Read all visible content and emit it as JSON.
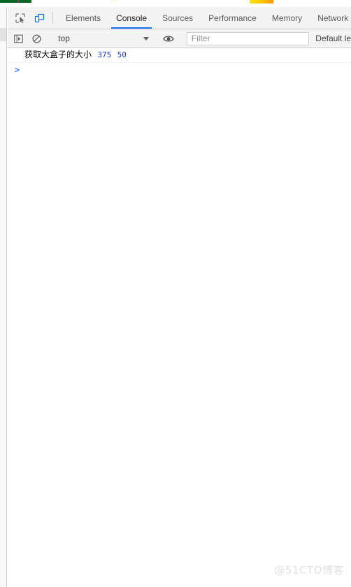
{
  "page_sliver": {
    "green_bar": "#0b6623",
    "purple_mark": "#7a3b6b",
    "orange_bar_start": "#ffe000",
    "orange_bar_end": "#ff9800"
  },
  "devtools": {
    "toolbar": {
      "inspect_icon": "inspect-element-icon",
      "device_icon": "device-toolbar-icon"
    },
    "tabs": [
      {
        "label": "Elements",
        "active": false
      },
      {
        "label": "Console",
        "active": true
      },
      {
        "label": "Sources",
        "active": false
      },
      {
        "label": "Performance",
        "active": false
      },
      {
        "label": "Memory",
        "active": false
      },
      {
        "label": "Network",
        "active": false
      }
    ],
    "active_tab_underline_color": "#1a73e8",
    "console_toolbar": {
      "sidebar_icon": "console-sidebar-icon",
      "clear_icon": "clear-console-icon",
      "context_value": "top",
      "eye_icon": "live-expression-eye-icon",
      "filter_value": "",
      "filter_placeholder": "Filter",
      "levels_label": "Default le"
    },
    "console_messages": [
      {
        "text": "获取大盒子的大小",
        "values": [
          "375",
          "50"
        ],
        "value_color": "#1a3ae0"
      }
    ],
    "prompt_caret": ">"
  },
  "watermark": "@51CTO博客"
}
